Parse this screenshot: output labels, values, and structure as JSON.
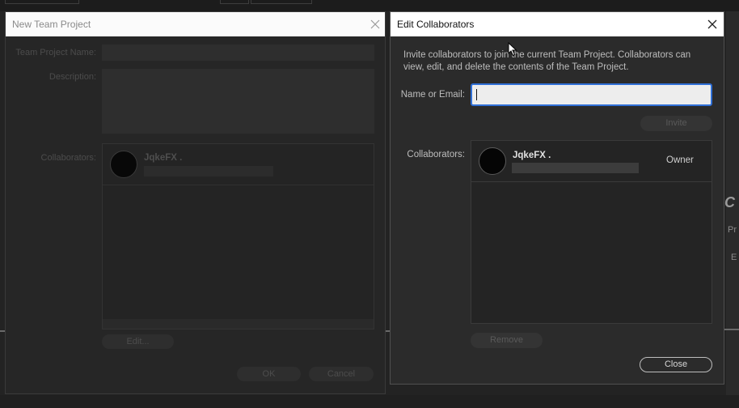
{
  "new_team_project": {
    "title": "New Team Project",
    "team_project_name_label": "Team Project Name:",
    "description_label": "Description:",
    "collaborators_label": "Collaborators:",
    "collaborator_name": "JqkeFX .",
    "edit_button": "Edit...",
    "ok_button": "OK",
    "cancel_button": "Cancel"
  },
  "edit_collaborators": {
    "title": "Edit Collaborators",
    "description": "Invite collaborators to join the current Team Project. Collaborators can view, edit, and delete the contents of the Team Project.",
    "name_or_email_label": "Name or Email:",
    "name_or_email_value": "",
    "invite_button": "Invite",
    "collaborators_label": "Collaborators:",
    "collaborators": [
      {
        "name": "JqkeFX .",
        "role": "Owner"
      }
    ],
    "remove_button": "Remove",
    "close_button": "Close"
  },
  "icons": {
    "close": "close-icon",
    "avatar": "avatar",
    "cursor": "mouse-pointer-icon"
  },
  "colors": {
    "dialog_bg": "#2b2b2b",
    "titlebar_bg": "#ffffff",
    "input_focus_border": "#2f6fd6"
  }
}
